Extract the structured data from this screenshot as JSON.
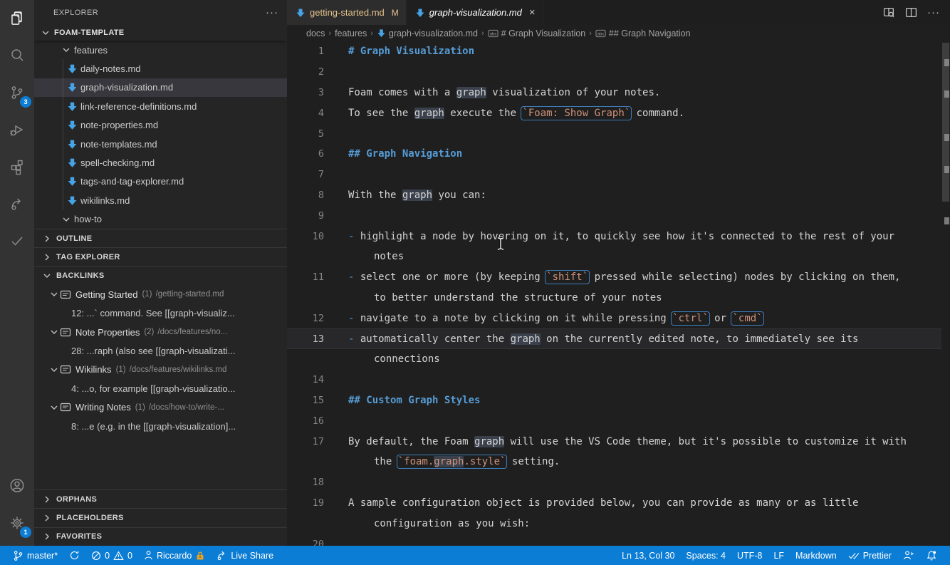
{
  "activity_bar": {
    "items": [
      {
        "id": "explorer",
        "active": true
      },
      {
        "id": "search"
      },
      {
        "id": "source-control",
        "badge": "3"
      },
      {
        "id": "run-debug"
      },
      {
        "id": "extensions"
      },
      {
        "id": "live-share"
      },
      {
        "id": "checks"
      }
    ],
    "bottom": [
      {
        "id": "account"
      },
      {
        "id": "settings",
        "badge": "1"
      }
    ],
    "badges": {
      "source_control": "3",
      "settings": "1"
    }
  },
  "sidebar": {
    "title": "EXPLORER",
    "workspace": "FOAM-TEMPLATE",
    "tree": {
      "folder": "features",
      "files": [
        "daily-notes.md",
        "graph-visualization.md",
        "link-reference-definitions.md",
        "note-properties.md",
        "note-templates.md",
        "spell-checking.md",
        "tags-and-tag-explorer.md",
        "wikilinks.md"
      ],
      "selected": "graph-visualization.md",
      "folder_after": "how-to"
    },
    "sections": {
      "outline": "OUTLINE",
      "tag_explorer": "TAG EXPLORER",
      "backlinks": "BACKLINKS",
      "orphans": "ORPHANS",
      "placeholders": "PLACEHOLDERS",
      "favorites": "FAVORITES"
    },
    "backlinks": [
      {
        "title": "Getting Started",
        "count": "(1)",
        "path": "/getting-started.md",
        "snippet": "12: ...` command. See [[graph-visualiz..."
      },
      {
        "title": "Note Properties",
        "count": "(2)",
        "path": "/docs/features/no...",
        "snippet": "28: ...raph (also see [[graph-visualizati..."
      },
      {
        "title": "Wikilinks",
        "count": "(1)",
        "path": "/docs/features/wikilinks.md",
        "snippet": "4: ...o, for example [[graph-visualizatio..."
      },
      {
        "title": "Writing Notes",
        "count": "(1)",
        "path": "/docs/how-to/write-...",
        "snippet": "8: ...e (e.g. in the [[graph-visualization]..."
      }
    ]
  },
  "tabs": [
    {
      "label": "getting-started.md",
      "badge": "M",
      "state": "modified"
    },
    {
      "label": "graph-visualization.md",
      "close": "×",
      "state": "active-preview"
    }
  ],
  "breadcrumbs": {
    "items": [
      "docs",
      "features",
      "graph-visualization.md",
      "# Graph Visualization",
      "## Graph Navigation"
    ]
  },
  "editor": {
    "rows": [
      {
        "n": "1",
        "seg": [
          {
            "s": "h",
            "t": "# Graph Visualization"
          }
        ]
      },
      {
        "n": "2",
        "seg": []
      },
      {
        "n": "3",
        "seg": [
          {
            "s": "p",
            "t": "Foam comes with a "
          },
          {
            "s": "hl",
            "t": "graph"
          },
          {
            "s": "p",
            "t": " visualization of your notes."
          }
        ]
      },
      {
        "n": "4",
        "seg": [
          {
            "s": "p",
            "t": "To see the "
          },
          {
            "s": "hl",
            "t": "graph"
          },
          {
            "s": "p",
            "t": " execute the "
          },
          {
            "s": "box",
            "parts": [
              {
                "s": "c",
                "t": "`Foam: Show Graph`"
              }
            ]
          },
          {
            "s": "p",
            "t": " command."
          }
        ]
      },
      {
        "n": "5",
        "seg": []
      },
      {
        "n": "6",
        "seg": [
          {
            "s": "h",
            "t": "## Graph Navigation"
          }
        ]
      },
      {
        "n": "7",
        "seg": []
      },
      {
        "n": "8",
        "seg": [
          {
            "s": "p",
            "t": "With the "
          },
          {
            "s": "hl",
            "t": "graph"
          },
          {
            "s": "p",
            "t": " you can:"
          }
        ]
      },
      {
        "n": "9",
        "seg": []
      },
      {
        "n": "10",
        "seg": [
          {
            "s": "pm",
            "t": "-"
          },
          {
            "s": "p",
            "t": " highlight a node by hovering on it, to quickly see how it's connected to the rest of your"
          }
        ]
      },
      {
        "n": "",
        "wrap": true,
        "seg": [
          {
            "s": "p",
            "t": "notes"
          }
        ]
      },
      {
        "n": "11",
        "seg": [
          {
            "s": "pm",
            "t": "-"
          },
          {
            "s": "p",
            "t": " select one or more (by keeping "
          },
          {
            "s": "box",
            "parts": [
              {
                "s": "c",
                "t": "`shift`"
              }
            ]
          },
          {
            "s": "p",
            "t": " pressed while selecting) nodes by clicking on them,"
          }
        ]
      },
      {
        "n": "",
        "wrap": true,
        "seg": [
          {
            "s": "p",
            "t": "to better understand the structure of your notes"
          }
        ]
      },
      {
        "n": "12",
        "seg": [
          {
            "s": "pm",
            "t": "-"
          },
          {
            "s": "p",
            "t": " navigate to a note by clicking on it while pressing "
          },
          {
            "s": "box",
            "parts": [
              {
                "s": "c",
                "t": "`ctrl`"
              }
            ]
          },
          {
            "s": "p",
            "t": " or "
          },
          {
            "s": "box",
            "parts": [
              {
                "s": "c",
                "t": "`cmd`"
              }
            ]
          }
        ]
      },
      {
        "n": "13",
        "cur": true,
        "seg": [
          {
            "s": "pm",
            "t": "-"
          },
          {
            "s": "p",
            "t": " automatically center the "
          },
          {
            "s": "hl",
            "t": "graph"
          },
          {
            "s": "p",
            "t": " on the currently edited note, to immediately see its"
          }
        ]
      },
      {
        "n": "",
        "wrap": true,
        "seg": [
          {
            "s": "p",
            "t": "connections"
          }
        ]
      },
      {
        "n": "14",
        "seg": []
      },
      {
        "n": "15",
        "seg": [
          {
            "s": "h",
            "t": "## Custom Graph Styles"
          }
        ]
      },
      {
        "n": "16",
        "seg": []
      },
      {
        "n": "17",
        "seg": [
          {
            "s": "p",
            "t": "By default, the Foam "
          },
          {
            "s": "hl",
            "t": "graph"
          },
          {
            "s": "p",
            "t": " will use the VS Code theme, but it's possible to customize it with"
          }
        ]
      },
      {
        "n": "",
        "wrap": true,
        "seg": [
          {
            "s": "p",
            "t": "the "
          },
          {
            "s": "box",
            "parts": [
              {
                "s": "c",
                "t": "`foam."
              },
              {
                "s": "chl",
                "t": "graph"
              },
              {
                "s": "c",
                "t": ".style`"
              }
            ]
          },
          {
            "s": "p",
            "t": " setting."
          }
        ]
      },
      {
        "n": "18",
        "seg": []
      },
      {
        "n": "19",
        "seg": [
          {
            "s": "p",
            "t": "A sample configuration object is provided below, you can provide as many or as little"
          }
        ]
      },
      {
        "n": "",
        "wrap": true,
        "seg": [
          {
            "s": "p",
            "t": "configuration as you wish:"
          }
        ]
      },
      {
        "n": "20",
        "seg": []
      }
    ]
  },
  "status_bar": {
    "branch": "master*",
    "errors": "0",
    "warnings": "0",
    "account": "Riccardo",
    "live_share": "Live Share",
    "cursor": "Ln 13, Col 30",
    "indentation": "Spaces: 4",
    "encoding": "UTF-8",
    "eol": "LF",
    "language": "Markdown",
    "formatter": "Prettier"
  },
  "colors": {
    "status_bar": "#0c7dd4",
    "badge": "#0c7dd4",
    "heading": "#569cd6",
    "inline_code": "#ce9178",
    "code_box_border": "#3d7dbb",
    "word_highlight": "#3a414d",
    "modified_tab": "#e2c08d",
    "markdown_icon": "#45a3e6",
    "lock": "#dfa32b"
  }
}
